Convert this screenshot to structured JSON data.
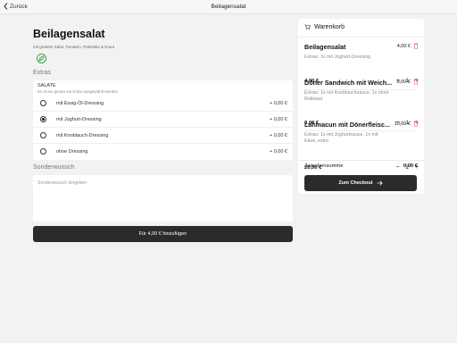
{
  "topbar": {
    "back_label": "Zurück",
    "title": "Beilagensalat"
  },
  "product": {
    "title": "Beilagensalat",
    "description": "mit grünem Salat, Tomaten, Petersilie & Kraut",
    "badge_icon": "vegetarian-icon"
  },
  "extras": {
    "section_label": "Extras",
    "group_title": "SALATE",
    "group_hint": "Es muss genau ein Extra ausgewählt werden",
    "options": [
      {
        "label": "mit Essig-Öl-Dressing",
        "price": "+ 0,00 €",
        "selected": false
      },
      {
        "label": "mit Joghurt-Dressing",
        "price": "+ 0,00 €",
        "selected": true
      },
      {
        "label": "mit Knoblauch-Dressing",
        "price": "+ 0,00 €",
        "selected": false
      },
      {
        "label": "ohne Dressing",
        "price": "+ 0,00 €",
        "selected": false
      }
    ]
  },
  "wish": {
    "section_label": "Sonderwunsch",
    "placeholder": "Sonderwunsch eingeben"
  },
  "add_button_label": "Für 4,00 € hinzufügen",
  "cart": {
    "title": "Warenkorb",
    "items": [
      {
        "name": "Beilagensalat",
        "price": "4,00 €",
        "extras": "Extras: 1x mit Joghurt-Dressing",
        "total": "4,00 €",
        "qty": "1"
      },
      {
        "name": "Döner Sandwich mit Weich...",
        "price": "8,00 €",
        "extras": "Extras: 1x mit Knoblauchsauce, 1x ohne Rotkraut",
        "total": "8,00 €",
        "qty": "1"
      },
      {
        "name": "Lahmacun mit Dönerfleisc...",
        "price": "10,00 €",
        "extras": "Extras: 1x mit Joghurtsauce, 1x mit Käse, extra",
        "total": "20,00 €",
        "qty": "2"
      }
    ],
    "subtotal_label": "Zwischensumme",
    "subtotal_value": "0,00 €",
    "checkout_label": "Zum Checkout"
  },
  "colors": {
    "background": "#f2f2f3",
    "button_dark": "#2b2b2d",
    "trash_red": "#e05a4f",
    "veg_green": "#46a546"
  }
}
